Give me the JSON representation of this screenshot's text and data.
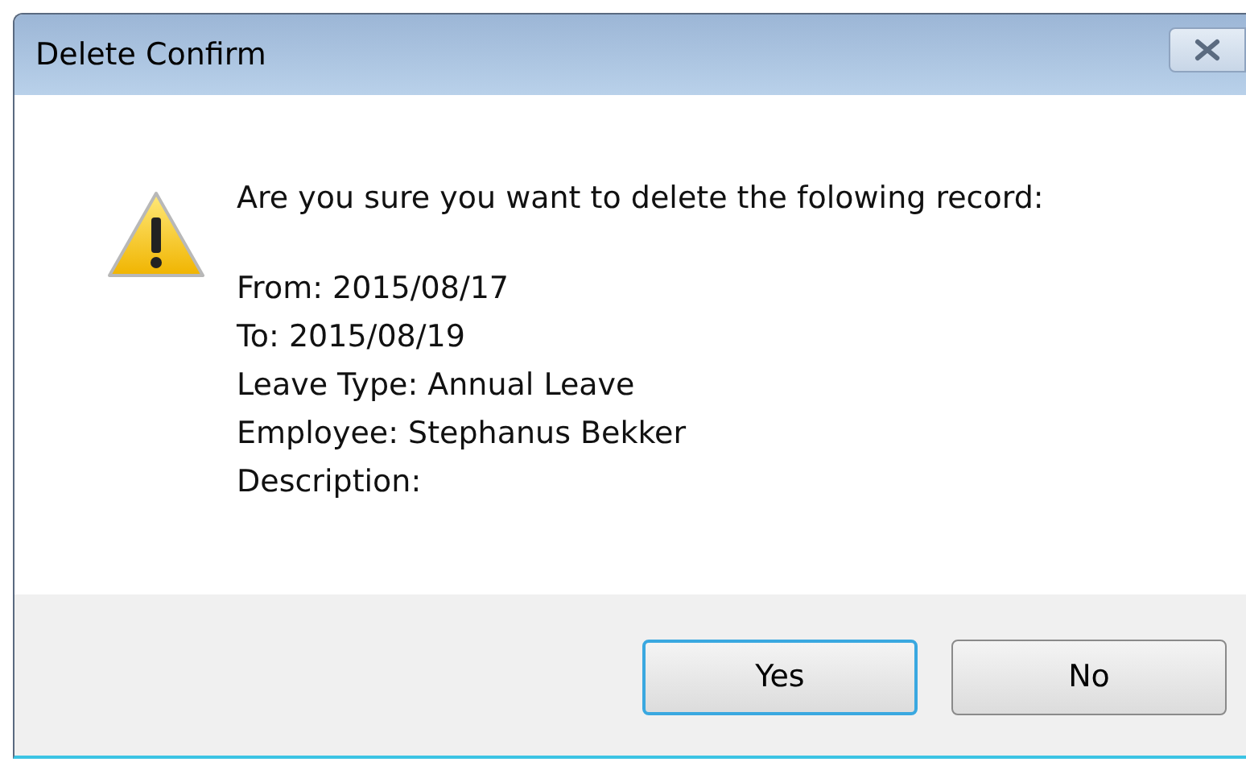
{
  "window": {
    "title": "Delete Confirm"
  },
  "message": "Are you sure you want to delete the folowing record:",
  "details": [
    "From: 2015/08/17",
    "To: 2015/08/19",
    "Leave Type: Annual Leave",
    "Employee: Stephanus Bekker",
    "Description:"
  ],
  "buttons": [
    {
      "label": "Yes",
      "selected": true
    },
    {
      "label": "No",
      "selected": false
    }
  ]
}
